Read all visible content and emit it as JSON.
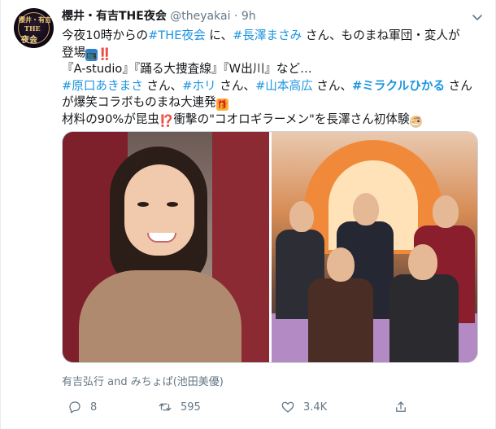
{
  "account": {
    "name": "櫻井・有吉THE夜会",
    "handle": "@theyakai",
    "separator": "·",
    "time": "9h",
    "avatar_text_1": "櫻井・有吉",
    "avatar_text_2": "THE",
    "avatar_text_3": "夜会"
  },
  "tweet": {
    "line1_a": "今夜10時からの",
    "line1_tag1": "#THE夜会",
    "line1_b": " に、",
    "line1_tag2": "#長澤まさみ",
    "line1_c": " さん、ものまね軍団・変人が",
    "line2_a": "登場",
    "emoji_tv": "📺",
    "emoji_bang": "‼️",
    "line3": "『A-studio』『踊る大捜査線』『W出川』など…",
    "line4_tag1": "#原口あきまさ",
    "line4_a": " さん、",
    "line4_tag2": "#ホリ",
    "line4_b": " さん、",
    "line4_tag3": "#山本高広",
    "line4_c": " さん、",
    "line4_tag4": "#ミラクルひかる",
    "line4_d": " さん",
    "line5": "が爆笑コラボものまね大連発",
    "emoji_gift": "🎁",
    "line6": "材料の90%が昆虫",
    "emoji_interrobang": "⁉️",
    "line6_b": "衝撃の\"コオロギラーメン\"を長澤さん初体験",
    "emoji_ramen": "🍜"
  },
  "caption": "有吉弘行 and みちょぱ(池田美優)",
  "stats": {
    "replies": "8",
    "retweets": "595",
    "likes": "3.4K"
  },
  "colors": {
    "link": "#1b95e0",
    "text": "#14171a",
    "muted": "#657786"
  }
}
